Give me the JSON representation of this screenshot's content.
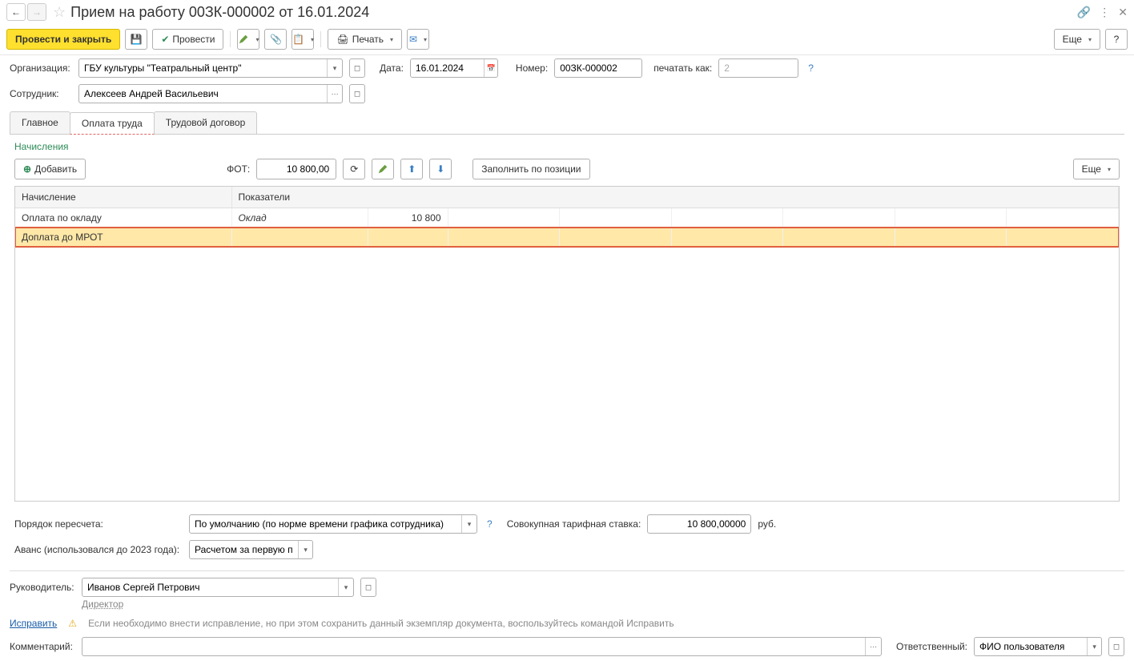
{
  "header": {
    "title": "Прием на работу 00ЗК-000002 от 16.01.2024"
  },
  "toolbar": {
    "post_close": "Провести и закрыть",
    "post": "Провести",
    "print": "Печать",
    "more": "Еще",
    "help": "?"
  },
  "fields": {
    "org_label": "Организация:",
    "org_value": "ГБУ культуры \"Театральный центр\"",
    "date_label": "Дата:",
    "date_value": "16.01.2024",
    "number_label": "Номер:",
    "number_value": "00ЗК-000002",
    "print_as_label": "печатать как:",
    "print_as_value": "2",
    "employee_label": "Сотрудник:",
    "employee_value": "Алексеев Андрей Васильевич"
  },
  "tabs": {
    "main": "Главное",
    "payment": "Оплата труда",
    "contract": "Трудовой договор"
  },
  "accruals": {
    "title": "Начисления",
    "add": "Добавить",
    "fot_label": "ФОТ:",
    "fot_value": "10 800,00",
    "fill_by_position": "Заполнить по позиции",
    "more": "Еще",
    "columns": {
      "accrual": "Начисление",
      "indicators": "Показатели"
    },
    "rows": [
      {
        "name": "Оплата по окладу",
        "indicator": "Оклад",
        "value": "10 800"
      },
      {
        "name": "Доплата до МРОТ",
        "indicator": "",
        "value": ""
      }
    ]
  },
  "bottom": {
    "recalc_label": "Порядок пересчета:",
    "recalc_value": "По умолчанию (по норме времени графика сотрудника)",
    "rate_label": "Совокупная тарифная ставка:",
    "rate_value": "10 800,00000",
    "rate_unit": "руб.",
    "advance_label": "Аванс (использовался до 2023 года):",
    "advance_value": "Расчетом за первую пол"
  },
  "footer": {
    "manager_label": "Руководитель:",
    "manager_value": "Иванов Сергей Петрович",
    "manager_position": "Директор",
    "fix_link": "Исправить",
    "fix_text": "Если необходимо внести исправление, но при этом сохранить данный экземпляр документа, воспользуйтесь командой Исправить",
    "comment_label": "Комментарий:",
    "responsible_label": "Ответственный:",
    "responsible_value": "ФИО пользователя"
  }
}
